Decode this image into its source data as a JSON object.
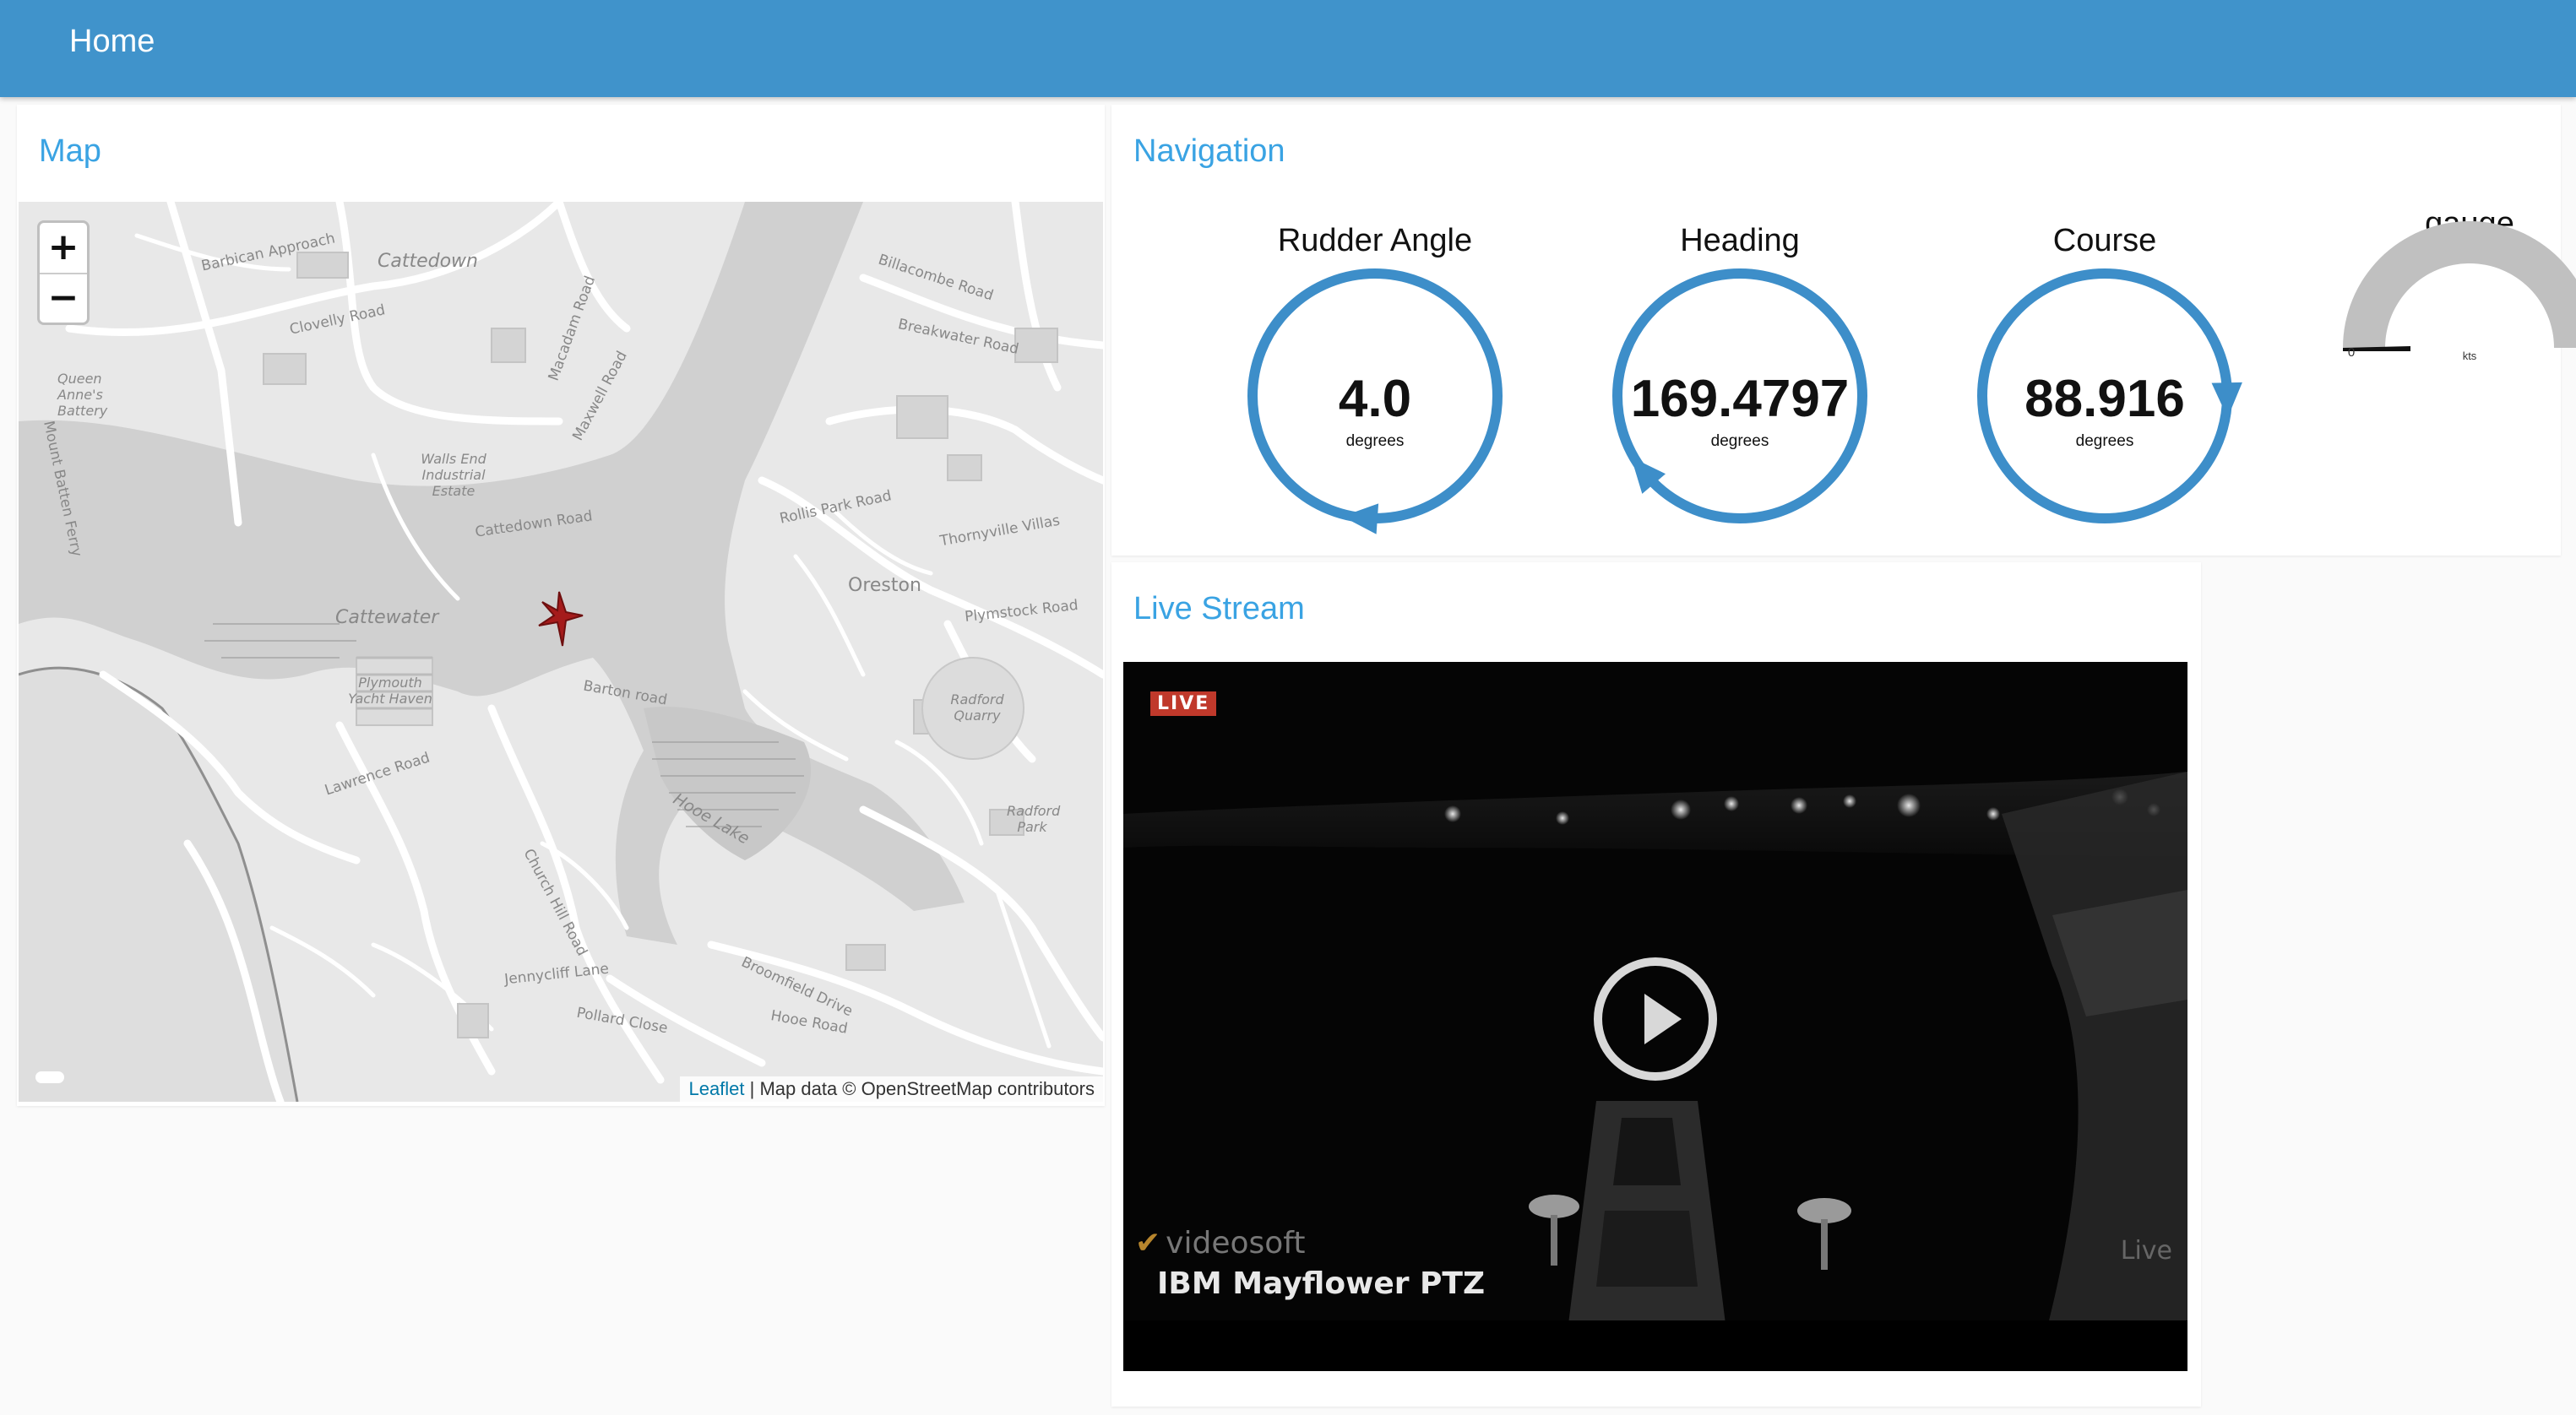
{
  "header": {
    "title": "Home"
  },
  "map": {
    "title": "Map",
    "zoom_in": "+",
    "zoom_out": "−",
    "attribution_link": "Leaflet",
    "attribution_text": " | Map data © OpenStreetMap contributors",
    "labels": {
      "cattedown": "Cattedown",
      "cattewater": "Cattewater",
      "oreston": "Oreston",
      "clovelly": "Clovelly Road",
      "barbican": "Barbican Approach",
      "billacombe": "Billacombe Road",
      "queen_annes": "Queen Anne's Battery",
      "walls_end": "Walls End Industrial Estate",
      "catt_road": "Cattedown Road",
      "maxwell": "Maxwell Road",
      "macadam": "Macadam Road",
      "lawrence": "Lawrence Road",
      "plymouth_yacht": "Plymouth Yacht Haven",
      "barton": "Barton road",
      "radford_quarry": "Radford Quarry",
      "radford_park": "Radford Park",
      "plymstock": "Plymstock Road",
      "hooe_lake": "Hooe Lake",
      "hooe_road": "Hooe Road",
      "jennycliff": "Jennycliff Lane",
      "breakwater": "Breakwater Road",
      "rollis": "Rollis Park Road",
      "thornyville": "Thornyville Villas",
      "church_hill": "Church Hill Road",
      "broomfield": "Broomfield Drive",
      "pollard": "Pollard Close",
      "mount_batten": "Mount Batten Ferry"
    }
  },
  "navigation": {
    "title": "Navigation",
    "gauges": [
      {
        "label": "Rudder Angle",
        "value": "4.0",
        "unit": "degrees",
        "angle_deg": 184
      },
      {
        "label": "Heading",
        "value": "169.4797",
        "unit": "degrees",
        "angle_deg": 229.5
      },
      {
        "label": "Course",
        "value": "88.916",
        "unit": "degrees",
        "angle_deg": 88.9
      }
    ],
    "speed_gauge": {
      "label": "gauge",
      "min": "0",
      "max": "10",
      "unit": "kts",
      "value": 0.3
    },
    "colors": {
      "gauge_ring": "#3d8ec9",
      "speed_arc": "#c0c0c0"
    }
  },
  "stream": {
    "title": "Live Stream",
    "live_badge": "LIVE",
    "camera_name": "IBM Mayflower PTZ",
    "logo_text": "videosoft",
    "live_watermark": "Live"
  }
}
